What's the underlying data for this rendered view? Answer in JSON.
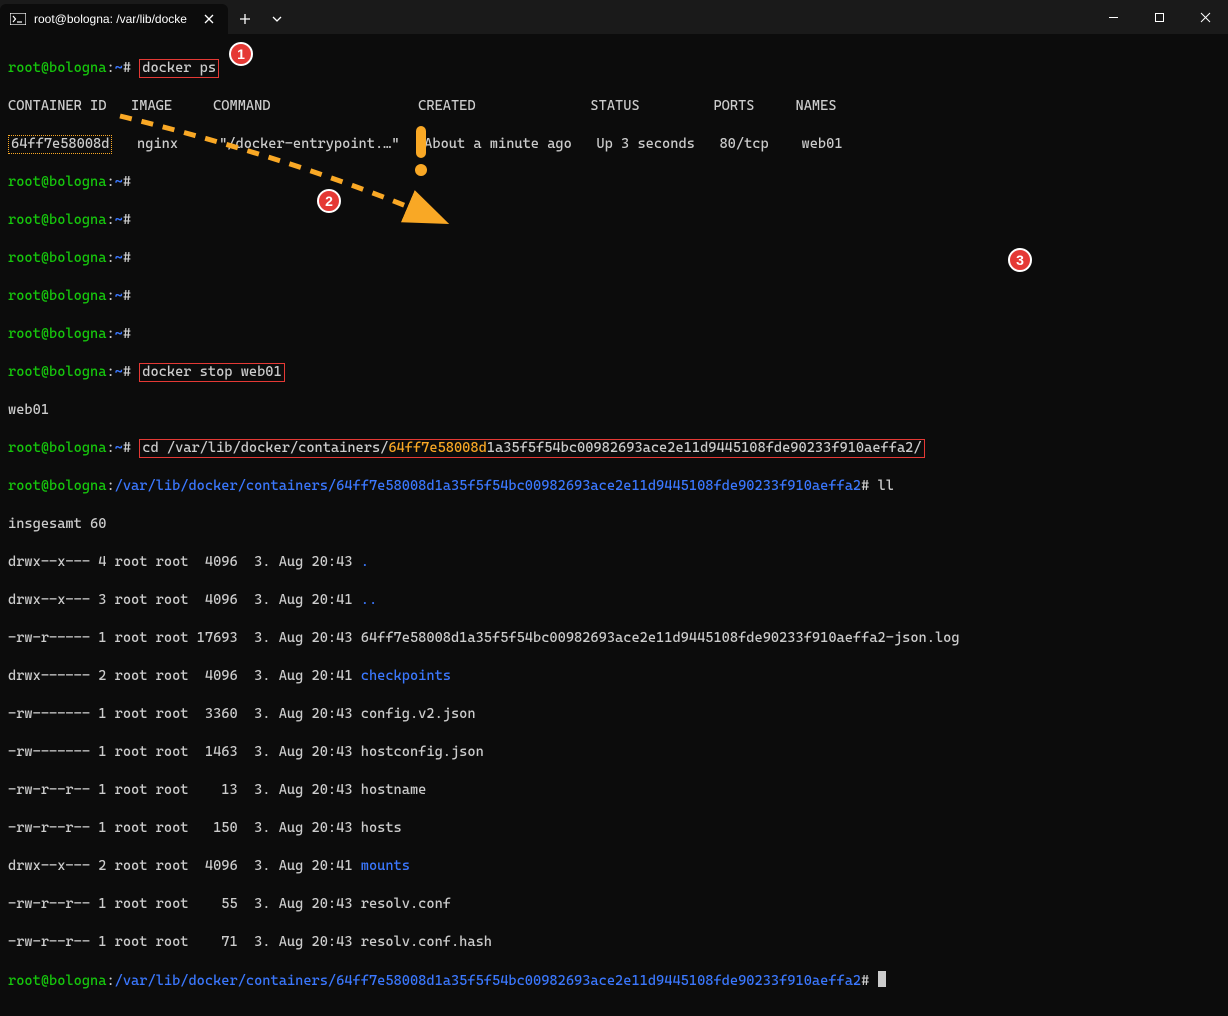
{
  "window": {
    "tab_title": "root@bologna: /var/lib/docke"
  },
  "prompt": {
    "user_host": "root@bologna",
    "home_path": "~",
    "long_path": "/var/lib/docker/containers/64ff7e58008d1a35f5f54bc00982693ace2e11d9445108fde90233f910aeffa2",
    "hash": "#"
  },
  "cmd": {
    "docker_ps": "docker ps",
    "docker_stop": "docker stop web01",
    "cd_prefix": "cd /var/lib/docker/containers/",
    "cd_id": "64ff7e58008d",
    "cd_rest": "1a35f5f54bc00982693ace2e11d9445108fde90233f910aeffa2/",
    "ll": "ll"
  },
  "ps": {
    "h1": "CONTAINER ID",
    "h2": "IMAGE",
    "h3": "COMMAND",
    "h4": "CREATED",
    "h5": "STATUS",
    "h6": "PORTS",
    "h7": "NAMES",
    "v1": "64ff7e58008d",
    "v2": "nginx",
    "v3": "\"/docker-entrypoint.…\"",
    "v4": "About a minute ago",
    "v5": "Up 3 seconds",
    "v6": "80/tcp",
    "v7": "web01"
  },
  "out": {
    "stop_echo": "web01",
    "total": "insgesamt 60"
  },
  "ls": {
    "r0": "drwx--x--- 4 root root  4096  3. Aug 20:43 ",
    "n0": ".",
    "r1": "drwx--x--- 3 root root  4096  3. Aug 20:41 ",
    "n1": "..",
    "r2": "-rw-r----- 1 root root 17693  3. Aug 20:43 64ff7e58008d1a35f5f54bc00982693ace2e11d9445108fde90233f910aeffa2-json.log",
    "r3": "drwx------ 2 root root  4096  3. Aug 20:41 ",
    "n3": "checkpoints",
    "r4": "-rw------- 1 root root  3360  3. Aug 20:43 config.v2.json",
    "r5": "-rw------- 1 root root  1463  3. Aug 20:43 hostconfig.json",
    "r6": "-rw-r--r-- 1 root root    13  3. Aug 20:43 hostname",
    "r7": "-rw-r--r-- 1 root root   150  3. Aug 20:43 hosts",
    "r8": "drwx--x--- 2 root root  4096  3. Aug 20:41 ",
    "n8": "mounts",
    "r9": "-rw-r--r-- 1 root root    55  3. Aug 20:43 resolv.conf",
    "r10": "-rw-r--r-- 1 root root    71  3. Aug 20:43 resolv.conf.hash"
  },
  "badges": {
    "b1": "1",
    "b2": "2",
    "b3": "3"
  }
}
